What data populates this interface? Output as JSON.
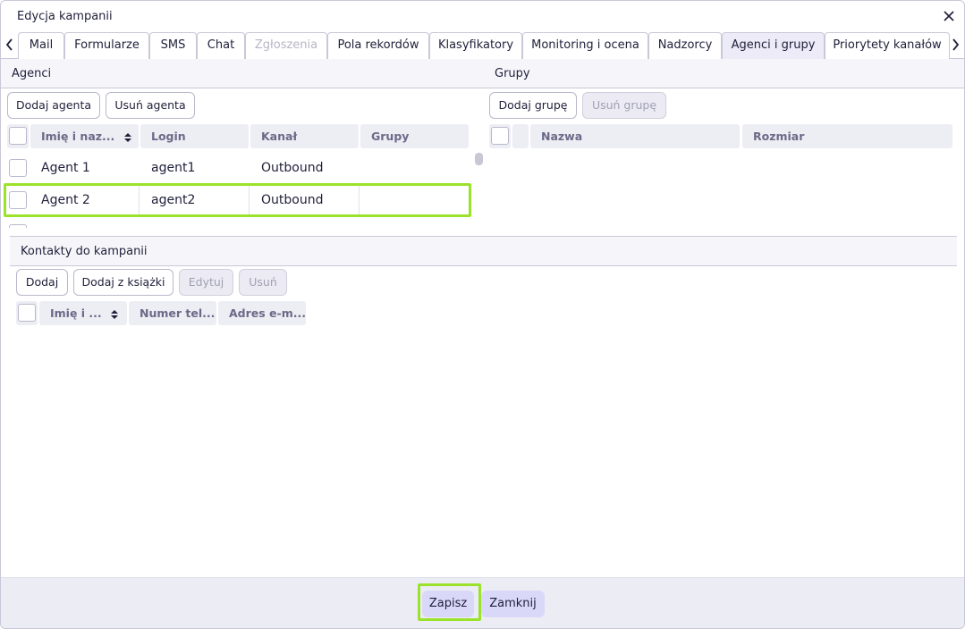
{
  "window": {
    "title": "Edycja kampanii"
  },
  "tabs": [
    {
      "label": "Mail",
      "state": "normal"
    },
    {
      "label": "Formularze",
      "state": "normal"
    },
    {
      "label": "SMS",
      "state": "normal"
    },
    {
      "label": "Chat",
      "state": "normal"
    },
    {
      "label": "Zgłoszenia",
      "state": "disabled"
    },
    {
      "label": "Pola rekordów",
      "state": "normal"
    },
    {
      "label": "Klasyfikatory",
      "state": "normal"
    },
    {
      "label": "Monitoring i ocena",
      "state": "normal"
    },
    {
      "label": "Nadzorcy",
      "state": "normal"
    },
    {
      "label": "Agenci i grupy",
      "state": "active"
    },
    {
      "label": "Priorytety kanałów",
      "state": "normal"
    }
  ],
  "agents": {
    "header": "Agenci",
    "add_button": "Dodaj agenta",
    "remove_button": "Usuń agenta",
    "columns": [
      "Imię i naz...",
      "Login",
      "Kanał",
      "Grupy"
    ],
    "rows": [
      {
        "name": "Agent 1",
        "login": "agent1",
        "channel": "Outbound",
        "groups": ""
      },
      {
        "name": "Agent 2",
        "login": "agent2",
        "channel": "Outbound",
        "groups": ""
      }
    ]
  },
  "groups": {
    "header": "Grupy",
    "add_button": "Dodaj grupę",
    "remove_button": "Usuń grupę",
    "columns": [
      "Nazwa",
      "Rozmiar"
    ]
  },
  "contacts": {
    "header": "Kontakty do kampanii",
    "add_button": "Dodaj",
    "add_from_book_button": "Dodaj z książki",
    "edit_button": "Edytuj",
    "remove_button": "Usuń",
    "columns": [
      "Imię i ...",
      "Numer tel...",
      "Adres e-m..."
    ]
  },
  "footer": {
    "save_button": "Zapisz",
    "close_button": "Zamknij"
  },
  "colors": {
    "highlight": "#9be22a",
    "active_tab": "#ecebf7",
    "footer_button": "#d9d8f8"
  }
}
